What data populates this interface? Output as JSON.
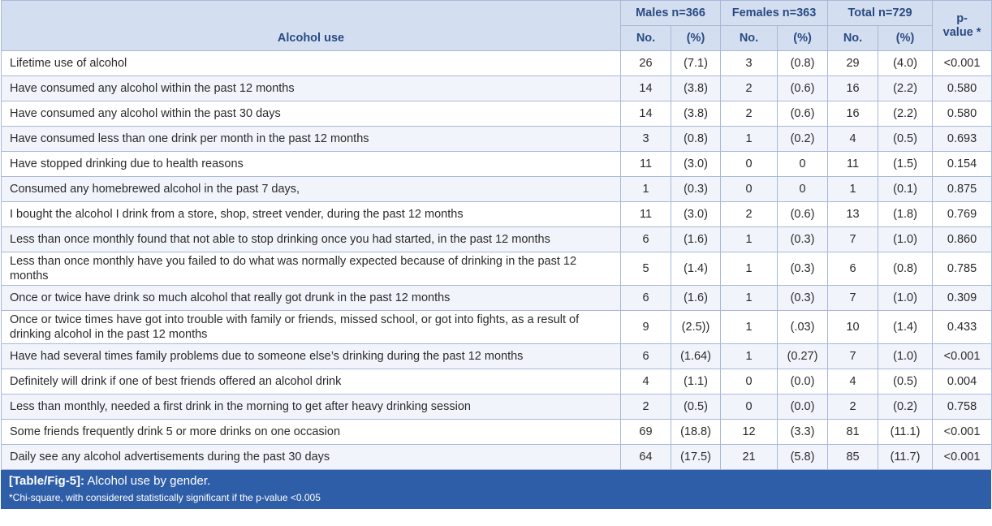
{
  "table": {
    "header_label": "Alcohol use",
    "groups": [
      "Males n=366",
      "Females n=363",
      "Total n=729"
    ],
    "sub_no": "No.",
    "sub_pct": "(%)",
    "pvalue_line1": "p-",
    "pvalue_line2": "value *",
    "rows": [
      {
        "label": "Lifetime use of alcohol",
        "m_no": "26",
        "m_pct": "(7.1)",
        "f_no": "3",
        "f_pct": "(0.8)",
        "t_no": "29",
        "t_pct": "(4.0)",
        "p": "<0.001"
      },
      {
        "label": "Have consumed any alcohol within the past 12 months",
        "m_no": "14",
        "m_pct": "(3.8)",
        "f_no": "2",
        "f_pct": "(0.6)",
        "t_no": "16",
        "t_pct": "(2.2)",
        "p": "0.580"
      },
      {
        "label": "Have consumed any alcohol within the past 30 days",
        "m_no": "14",
        "m_pct": "(3.8)",
        "f_no": "2",
        "f_pct": "(0.6)",
        "t_no": "16",
        "t_pct": "(2.2)",
        "p": "0.580"
      },
      {
        "label": "Have consumed less than one drink per month in the past 12 months",
        "m_no": "3",
        "m_pct": "(0.8)",
        "f_no": "1",
        "f_pct": "(0.2)",
        "t_no": "4",
        "t_pct": "(0.5)",
        "p": "0.693"
      },
      {
        "label": "Have stopped drinking due to health reasons",
        "m_no": "11",
        "m_pct": "(3.0)",
        "f_no": "0",
        "f_pct": "0",
        "t_no": "11",
        "t_pct": "(1.5)",
        "p": "0.154"
      },
      {
        "label": "Consumed any homebrewed alcohol in the past 7 days,",
        "m_no": "1",
        "m_pct": "(0.3)",
        "f_no": "0",
        "f_pct": "0",
        "t_no": "1",
        "t_pct": "(0.1)",
        "p": "0.875"
      },
      {
        "label": "I bought the alcohol I drink from a store, shop, street vender, during the past 12 months",
        "m_no": "11",
        "m_pct": "(3.0)",
        "f_no": "2",
        "f_pct": "(0.6)",
        "t_no": "13",
        "t_pct": "(1.8)",
        "p": "0.769"
      },
      {
        "label": "Less than once monthly found that not able to stop drinking once you had started, in the past 12 months",
        "m_no": "6",
        "m_pct": "(1.6)",
        "f_no": "1",
        "f_pct": "(0.3)",
        "t_no": "7",
        "t_pct": "(1.0)",
        "p": "0.860"
      },
      {
        "label": "Less than once monthly have you failed to do what was normally expected because of drinking in the past 12 months",
        "m_no": "5",
        "m_pct": "(1.4)",
        "f_no": "1",
        "f_pct": "(0.3)",
        "t_no": "6",
        "t_pct": "(0.8)",
        "p": "0.785",
        "tall": true
      },
      {
        "label": "Once or twice have drink so much alcohol that really got drunk in the past 12 months",
        "m_no": "6",
        "m_pct": "(1.6)",
        "f_no": "1",
        "f_pct": "(0.3)",
        "t_no": "7",
        "t_pct": "(1.0)",
        "p": "0.309"
      },
      {
        "label": "Once or twice times have got into trouble with family or friends, missed school, or got into fights, as a result of drinking alcohol in the past 12 months",
        "m_no": "9",
        "m_pct": "(2.5))",
        "f_no": "1",
        "f_pct": "(.03)",
        "t_no": "10",
        "t_pct": "(1.4)",
        "p": "0.433",
        "tall": true
      },
      {
        "label": "Have had several times family problems due to someone else’s drinking during the past 12 months",
        "m_no": "6",
        "m_pct": "(1.64)",
        "f_no": "1",
        "f_pct": "(0.27)",
        "t_no": "7",
        "t_pct": "(1.0)",
        "p": "<0.001"
      },
      {
        "label": "Definitely will drink if one of best friends offered an alcohol drink",
        "m_no": "4",
        "m_pct": "(1.1)",
        "f_no": "0",
        "f_pct": "(0.0)",
        "t_no": "4",
        "t_pct": "(0.5)",
        "p": "0.004"
      },
      {
        "label": "Less than monthly, needed a first drink in the morning to get after heavy drinking session",
        "m_no": "2",
        "m_pct": "(0.5)",
        "f_no": "0",
        "f_pct": "(0.0)",
        "t_no": "2",
        "t_pct": "(0.2)",
        "p": "0.758"
      },
      {
        "label": "Some friends frequently drink 5 or more drinks on one occasion",
        "m_no": "69",
        "m_pct": "(18.8)",
        "f_no": "12",
        "f_pct": "(3.3)",
        "t_no": "81",
        "t_pct": "(11.1)",
        "p": "<0.001"
      },
      {
        "label": "Daily see any alcohol advertisements during the past 30 days",
        "m_no": "64",
        "m_pct": "(17.5)",
        "f_no": "21",
        "f_pct": "(5.8)",
        "t_no": "85",
        "t_pct": "(11.7)",
        "p": "<0.001"
      }
    ]
  },
  "caption": {
    "tag": "[Table/Fig-5]:",
    "title": "Alcohol use by gender.",
    "footnote": "*Chi-square, with considered statistically significant if the p-value <0.005"
  }
}
